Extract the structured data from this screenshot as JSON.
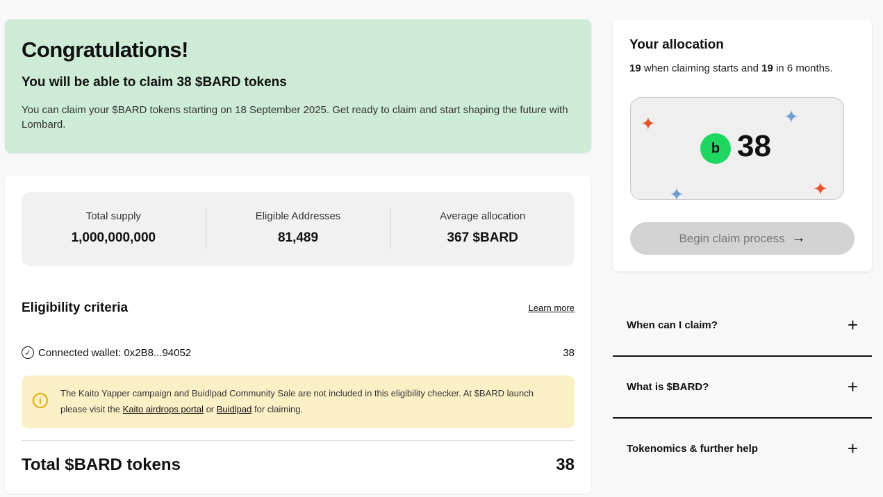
{
  "congrats": {
    "title": "Congratulations!",
    "subtitle": "You will be able to claim 38 $BARD tokens",
    "body": "You can claim your $BARD tokens starting on 18 September 2025. Get ready to claim and start shaping the future with Lombard."
  },
  "stats": [
    {
      "label": "Total supply",
      "value": "1,000,000,000"
    },
    {
      "label": "Eligible Addresses",
      "value": "81,489"
    },
    {
      "label": "Average allocation",
      "value": "367 $BARD"
    }
  ],
  "eligibility": {
    "title": "Eligibility criteria",
    "learn_more": "Learn more",
    "wallet_label": "Connected wallet: 0x2B8...94052",
    "wallet_count": "38",
    "notice_text_1": "The Kaito Yapper campaign and Buidlpad Community Sale are not included in this eligibility checker. At $BARD launch please visit the ",
    "notice_link_1": "Kaito airdrops portal",
    "notice_text_2": " or ",
    "notice_link_2": "Buidlpad",
    "notice_text_3": " for claiming.",
    "total_label": "Total $BARD tokens",
    "total_value": "38"
  },
  "allocation": {
    "title": "Your allocation",
    "now_amount": "19",
    "now_text": " when claiming starts and ",
    "later_amount": "19",
    "later_text": " in 6 months.",
    "amount": "38",
    "token_logo": "b",
    "claim_button": "Begin claim process",
    "accent": "#1ed760"
  },
  "faq": [
    {
      "question": "When can I claim?"
    },
    {
      "question": "What is $BARD?"
    },
    {
      "question": "Tokenomics & further help"
    }
  ]
}
